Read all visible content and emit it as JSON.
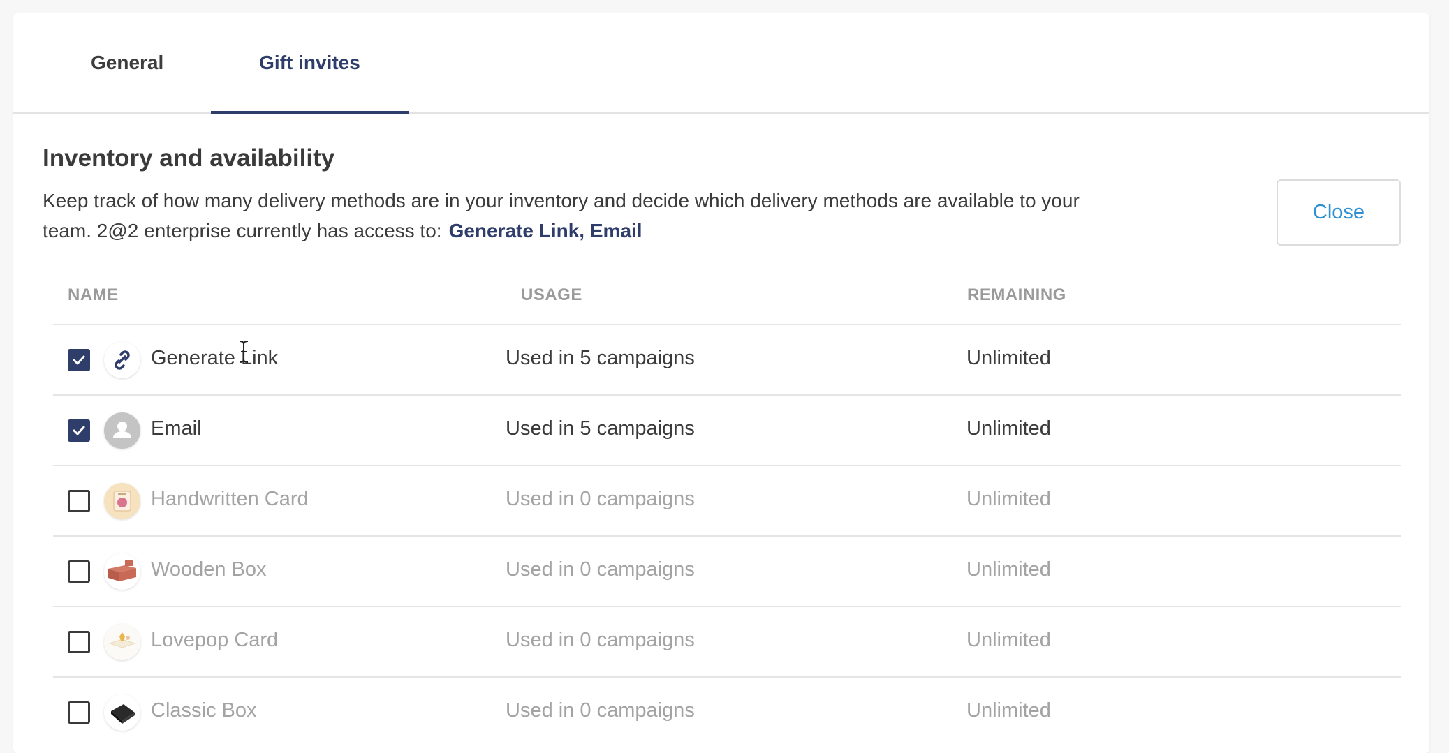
{
  "tabs": [
    {
      "label": "General"
    },
    {
      "label": "Gift invites"
    }
  ],
  "section": {
    "title": "Inventory and availability",
    "description": "Keep track of how many delivery methods are in your inventory and decide which delivery methods are available to your team. 2@2 enterprise currently has access to:",
    "access_list": "Generate Link, Email",
    "close_label": "Close"
  },
  "table": {
    "headers": {
      "name": "NAME",
      "usage": "USAGE",
      "remaining": "REMAINING"
    },
    "rows": [
      {
        "name": "Generate Link",
        "usage": "Used in 5 campaigns",
        "remaining": "Unlimited",
        "checked": true,
        "icon": "link-icon"
      },
      {
        "name": "Email",
        "usage": "Used in 5 campaigns",
        "remaining": "Unlimited",
        "checked": true,
        "icon": "user-icon"
      },
      {
        "name": "Handwritten Card",
        "usage": "Used in 0 campaigns",
        "remaining": "Unlimited",
        "checked": false,
        "icon": "handwritten-card-icon"
      },
      {
        "name": "Wooden Box",
        "usage": "Used in 0 campaigns",
        "remaining": "Unlimited",
        "checked": false,
        "icon": "wooden-box-icon"
      },
      {
        "name": "Lovepop Card",
        "usage": "Used in 0 campaigns",
        "remaining": "Unlimited",
        "checked": false,
        "icon": "lovepop-card-icon"
      },
      {
        "name": "Classic Box",
        "usage": "Used in 0 campaigns",
        "remaining": "Unlimited",
        "checked": false,
        "icon": "classic-box-icon"
      }
    ]
  },
  "colors": {
    "accent": "#2f3d6b",
    "link": "#2e8fd4",
    "muted": "#a3a3a3"
  }
}
